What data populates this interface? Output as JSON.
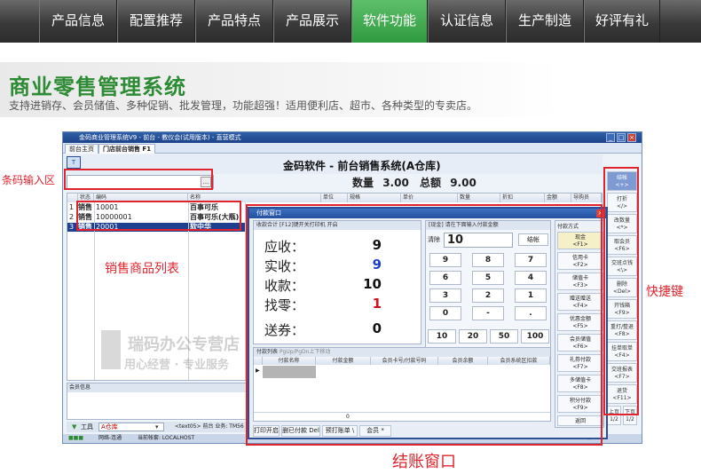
{
  "nav": {
    "items": [
      {
        "label": "产品信息",
        "active": false
      },
      {
        "label": "配置推荐",
        "active": false
      },
      {
        "label": "产品特点",
        "active": false
      },
      {
        "label": "产品展示",
        "active": false
      },
      {
        "label": "软件功能",
        "active": true
      },
      {
        "label": "认证信息",
        "active": false
      },
      {
        "label": "生产制造",
        "active": false
      },
      {
        "label": "好评有礼",
        "active": false
      }
    ]
  },
  "banner": {
    "title": "商业零售管理系统",
    "subtitle": "支持进销存、会员储值、多种促销、批发管理，功能超强！适用便利店、超市、各种类型的专卖店。"
  },
  "app": {
    "window_title": "金码商业管理系统V9 - 前台 - 教仪会(试用版本) - 直营模式",
    "tabs": [
      "前台主页",
      "门店前台销售 F1"
    ],
    "header_title": "金码软件 - 前台销售系统(A仓库)",
    "barcode_dots": "...",
    "quantity_label": "数量",
    "quantity_value": "3.00",
    "total_label": "总额",
    "total_value": "9.00",
    "grid_columns": [
      "状态",
      "编码",
      "名称",
      "单位",
      "规格",
      "单价",
      "数量",
      "折扣",
      "金额",
      "导购员"
    ],
    "rows": [
      {
        "no": "1",
        "status": "销售",
        "code": "10001",
        "name": "百事可乐"
      },
      {
        "no": "2",
        "status": "销售",
        "code": "10000001",
        "name": "百事可乐(大瓶)"
      },
      {
        "no": "3",
        "status": "销售",
        "code": "20001",
        "name": "软中华",
        "selected": true
      }
    ],
    "member_panel_title": "会员信息",
    "bottom_tools": "工具",
    "warehouse": "A仓库",
    "bottom_hint": "<text05>  前台 业务: TM56",
    "status_network": "网络-连通",
    "status_account": "当前帐套: LOCALHOST",
    "status_ime": "中",
    "shortcuts": [
      {
        "label": "结帐",
        "key": "<+>"
      },
      {
        "label": "打折",
        "key": "</>"
      },
      {
        "label": "改数量",
        "key": "<*>"
      },
      {
        "label": "取会员",
        "key": "<F6>"
      },
      {
        "label": "交班点钱",
        "key": "<\\>"
      },
      {
        "label": "删除",
        "key": "<Del>"
      },
      {
        "label": "开钱箱",
        "key": "<F9>"
      },
      {
        "label": "重打/整退",
        "key": "<F8>"
      },
      {
        "label": "挂单取单",
        "key": "<F4>"
      },
      {
        "label": "交班报表",
        "key": "<F7>"
      },
      {
        "label": "退货",
        "key": "<F11>"
      },
      {
        "label": "上页 1/2",
        "key": ""
      },
      {
        "label": "下页 1/2",
        "key": ""
      }
    ]
  },
  "pay": {
    "title": "付款窗口",
    "close": "×",
    "summary_header": "收款合计 [F12]键开关打印机 开启",
    "should_pay_label": "应收：",
    "should_pay_value": "9",
    "actual_label": "实收：",
    "actual_value": "9",
    "received_label": "收款：",
    "received_value": "10",
    "change_label": "找零：",
    "change_value": "1",
    "coupon_label": "送券：",
    "coupon_value": "0",
    "keypad_header": "[现金] 请在下面输入付款金额",
    "clear_label": "清除",
    "input_value": "10",
    "checkout_label": "结帐",
    "keys": [
      "9",
      "8",
      "7",
      "6",
      "5",
      "4",
      "3",
      "2",
      "1",
      "0",
      "-",
      "."
    ],
    "quick_amounts": [
      "10",
      "20",
      "50",
      "100"
    ],
    "methods_title": "付款方式",
    "methods": [
      {
        "label": "现金",
        "key": "<F1>"
      },
      {
        "label": "信用卡",
        "key": "<F2>"
      },
      {
        "label": "储值卡",
        "key": "<F3>"
      },
      {
        "label": "赠送赠送",
        "key": "<F4>"
      },
      {
        "label": "优惠金额",
        "key": "<F5>"
      },
      {
        "label": "会员储值",
        "key": "<F6>"
      },
      {
        "label": "礼券付款",
        "key": "<F7>"
      },
      {
        "label": "多储值卡",
        "key": "<F8>"
      },
      {
        "label": "积分付款",
        "key": "<F9>"
      },
      {
        "label": "返回",
        "key": ""
      }
    ],
    "list_header": "付款列表",
    "list_hint": "PgUp/PgDn上下移动",
    "list_columns": [
      "付款名称",
      "付款金额",
      "会员卡号/付款号码",
      "会员余额",
      "会员系统区扣款"
    ],
    "list_total": "0",
    "footer_buttons": [
      "打印开启",
      "删已付款 Del",
      "预打账单 \\",
      "会员 *"
    ]
  },
  "annotations": {
    "barcode_area": "条码输入区",
    "product_list": "销售商品列表",
    "shortcuts": "快捷键",
    "checkout_window": "结账窗口"
  },
  "watermark": {
    "line1": "瑞码办公专营店",
    "line2": "用心经营 · 专业服务"
  },
  "colors": {
    "nav_active": "#2f9a3f",
    "banner_title": "#2e8b35",
    "annotation_red": "#e0232d",
    "selected_row": "#1f3f8f"
  }
}
